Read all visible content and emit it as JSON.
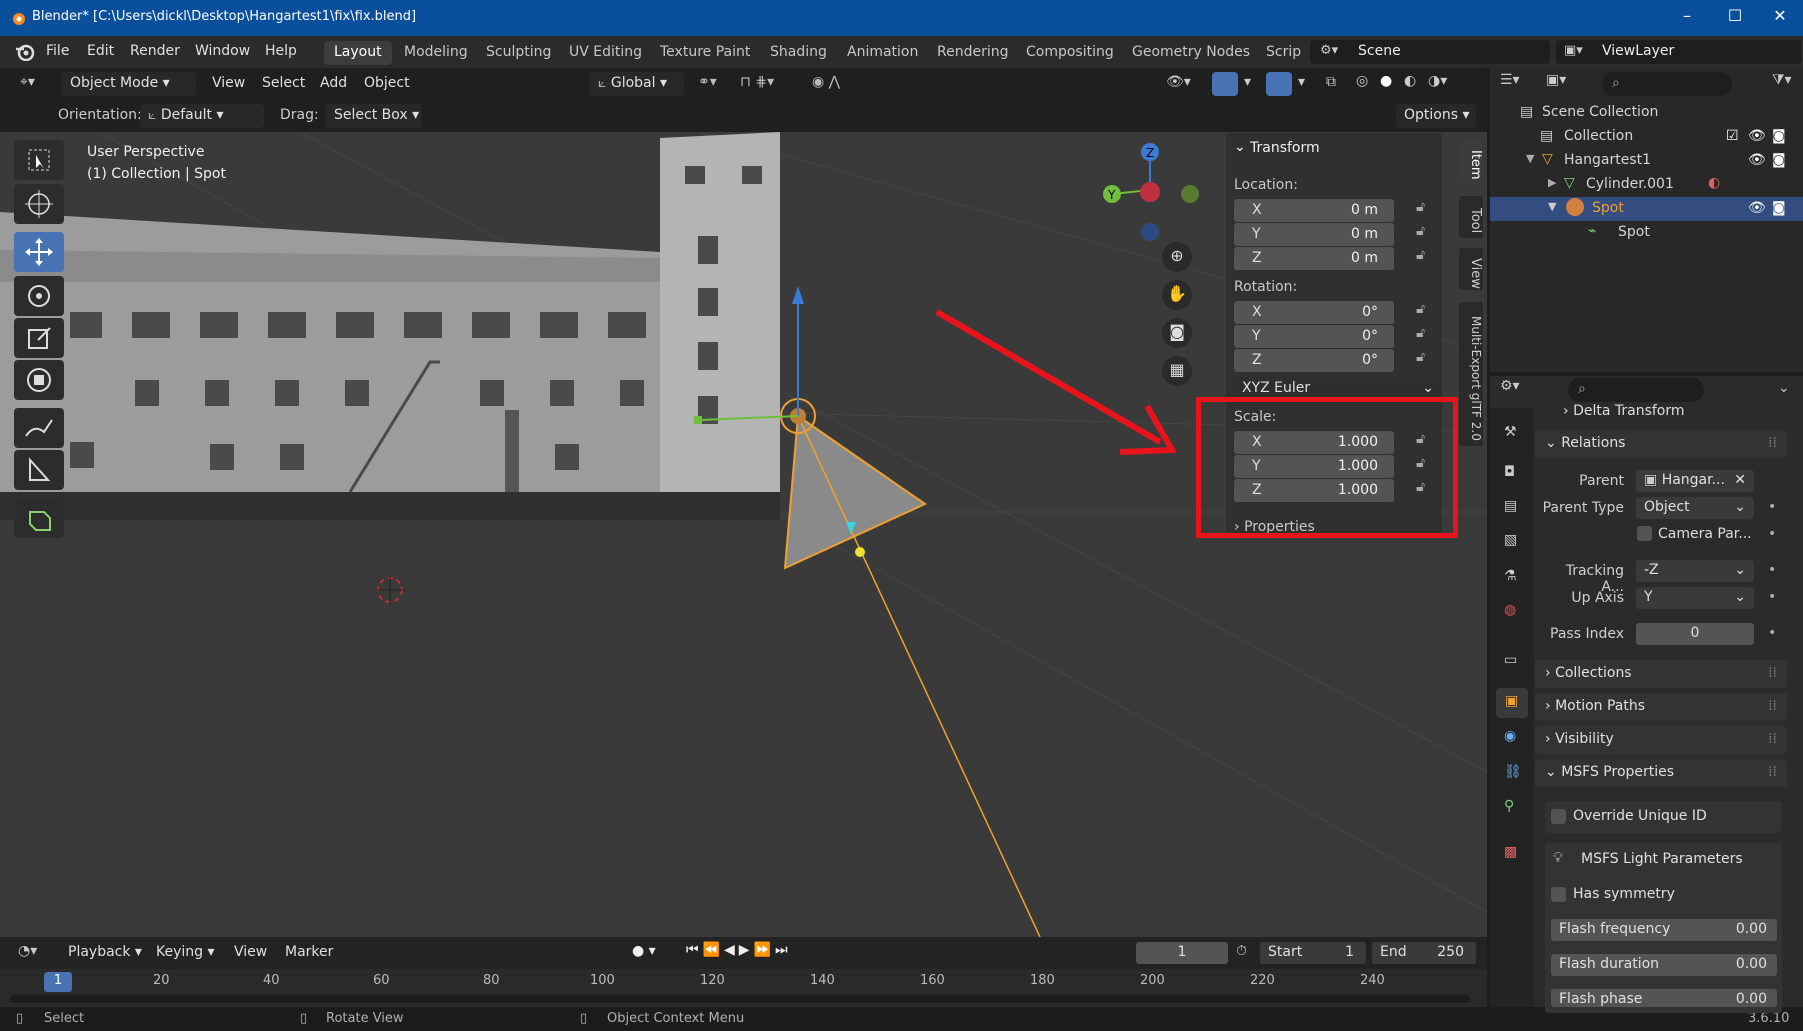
{
  "window": {
    "title": "Blender* [C:\\Users\\dickl\\Desktop\\Hangartest1\\fix\\fix.blend]",
    "controls": [
      "–",
      "☐",
      "✕"
    ]
  },
  "menu": {
    "items": [
      "File",
      "Edit",
      "Render",
      "Window",
      "Help"
    ],
    "workspaces": [
      "Layout",
      "Modeling",
      "Sculpting",
      "UV Editing",
      "Texture Paint",
      "Shading",
      "Animation",
      "Rendering",
      "Compositing",
      "Geometry Nodes",
      "Scrip"
    ],
    "active_workspace": "Layout",
    "scene": "Scene",
    "view_layer": "ViewLayer"
  },
  "viewport_header": {
    "mode": "Object Mode",
    "menus": [
      "View",
      "Select",
      "Add",
      "Object"
    ],
    "transform_orientation": "Global",
    "orientation_label": "Orientation:",
    "orientation_value": "Default",
    "drag_label": "Drag:",
    "drag_value": "Select Box",
    "options_label": "Options"
  },
  "viewport": {
    "perspective": "User Perspective",
    "context": "(1) Collection | Spot"
  },
  "n_panel": {
    "header": "Transform",
    "location_label": "Location:",
    "location": [
      {
        "axis": "X",
        "value": "0 m"
      },
      {
        "axis": "Y",
        "value": "0 m"
      },
      {
        "axis": "Z",
        "value": "0 m"
      }
    ],
    "rotation_label": "Rotation:",
    "rotation": [
      {
        "axis": "X",
        "value": "0°"
      },
      {
        "axis": "Y",
        "value": "0°"
      },
      {
        "axis": "Z",
        "value": "0°"
      }
    ],
    "rotation_mode": "XYZ Euler",
    "scale_label": "Scale:",
    "scale": [
      {
        "axis": "X",
        "value": "1.000"
      },
      {
        "axis": "Y",
        "value": "1.000"
      },
      {
        "axis": "Z",
        "value": "1.000"
      }
    ],
    "properties_label": "Properties",
    "tabs": [
      "Item",
      "Tool",
      "View",
      "Multi-Export glTF 2.0"
    ]
  },
  "outliner": {
    "rows": [
      {
        "label": "Scene Collection"
      },
      {
        "label": "Collection"
      },
      {
        "label": "Hangartest1"
      },
      {
        "label": "Cylinder.001"
      },
      {
        "label": "Spot"
      },
      {
        "label": "Spot"
      }
    ]
  },
  "properties": {
    "delta_transform": "Delta Transform",
    "relations": "Relations",
    "parent_label": "Parent",
    "parent_value": "Hangar...",
    "parent_type_label": "Parent Type",
    "parent_type_value": "Object",
    "camera_parent": "Camera Par...",
    "tracking_label": "Tracking A...",
    "tracking_value": "-Z",
    "up_axis_label": "Up Axis",
    "up_axis_value": "Y",
    "pass_index_label": "Pass Index",
    "pass_index_value": "0",
    "collections": "Collections",
    "motion_paths": "Motion Paths",
    "visibility": "Visibility",
    "msfs_properties": "MSFS Properties",
    "override_uid": "Override Unique ID",
    "msfs_light_params": "MSFS Light Parameters",
    "has_symmetry": "Has symmetry",
    "flash_frequency_label": "Flash frequency",
    "flash_frequency_value": "0.00",
    "flash_duration_label": "Flash duration",
    "flash_duration_value": "0.00",
    "flash_phase_label": "Flash phase",
    "flash_phase_value": "0.00"
  },
  "timeline": {
    "menus": [
      "Playback",
      "Keying",
      "View",
      "Marker"
    ],
    "current_frame": "1",
    "start_label": "Start",
    "start_value": "1",
    "end_label": "End",
    "end_value": "250",
    "ruler": [
      "1",
      "20",
      "40",
      "60",
      "80",
      "100",
      "120",
      "140",
      "160",
      "180",
      "200",
      "220",
      "240"
    ]
  },
  "status": {
    "select": "Select",
    "rotate": "Rotate View",
    "context_menu": "Object Context Menu",
    "version": "3.6.10"
  },
  "colors": {
    "accent": "#4772b3",
    "selection": "#334d80",
    "highlight_box": "#e8141c",
    "spot_orange": "#f0a030"
  }
}
